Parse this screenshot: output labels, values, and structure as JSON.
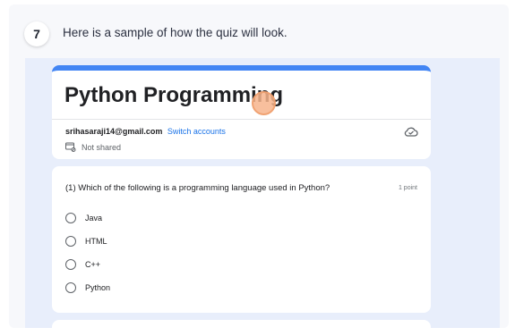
{
  "step": {
    "number": "7",
    "text": "Here is a sample of how the quiz will look."
  },
  "form": {
    "title": "Python Programming",
    "email": "srihasaraji14@gmail.com",
    "switch_label": "Switch accounts",
    "share_status": "Not shared",
    "accent_color": "#4285f4"
  },
  "question": {
    "text": "(1) Which of the following is a programming language used in Python?",
    "points": "1 point",
    "options": [
      "Java",
      "HTML",
      "C++",
      "Python"
    ]
  },
  "icons": {
    "share": "not-shared-icon",
    "cloud": "cloud-check-icon"
  }
}
